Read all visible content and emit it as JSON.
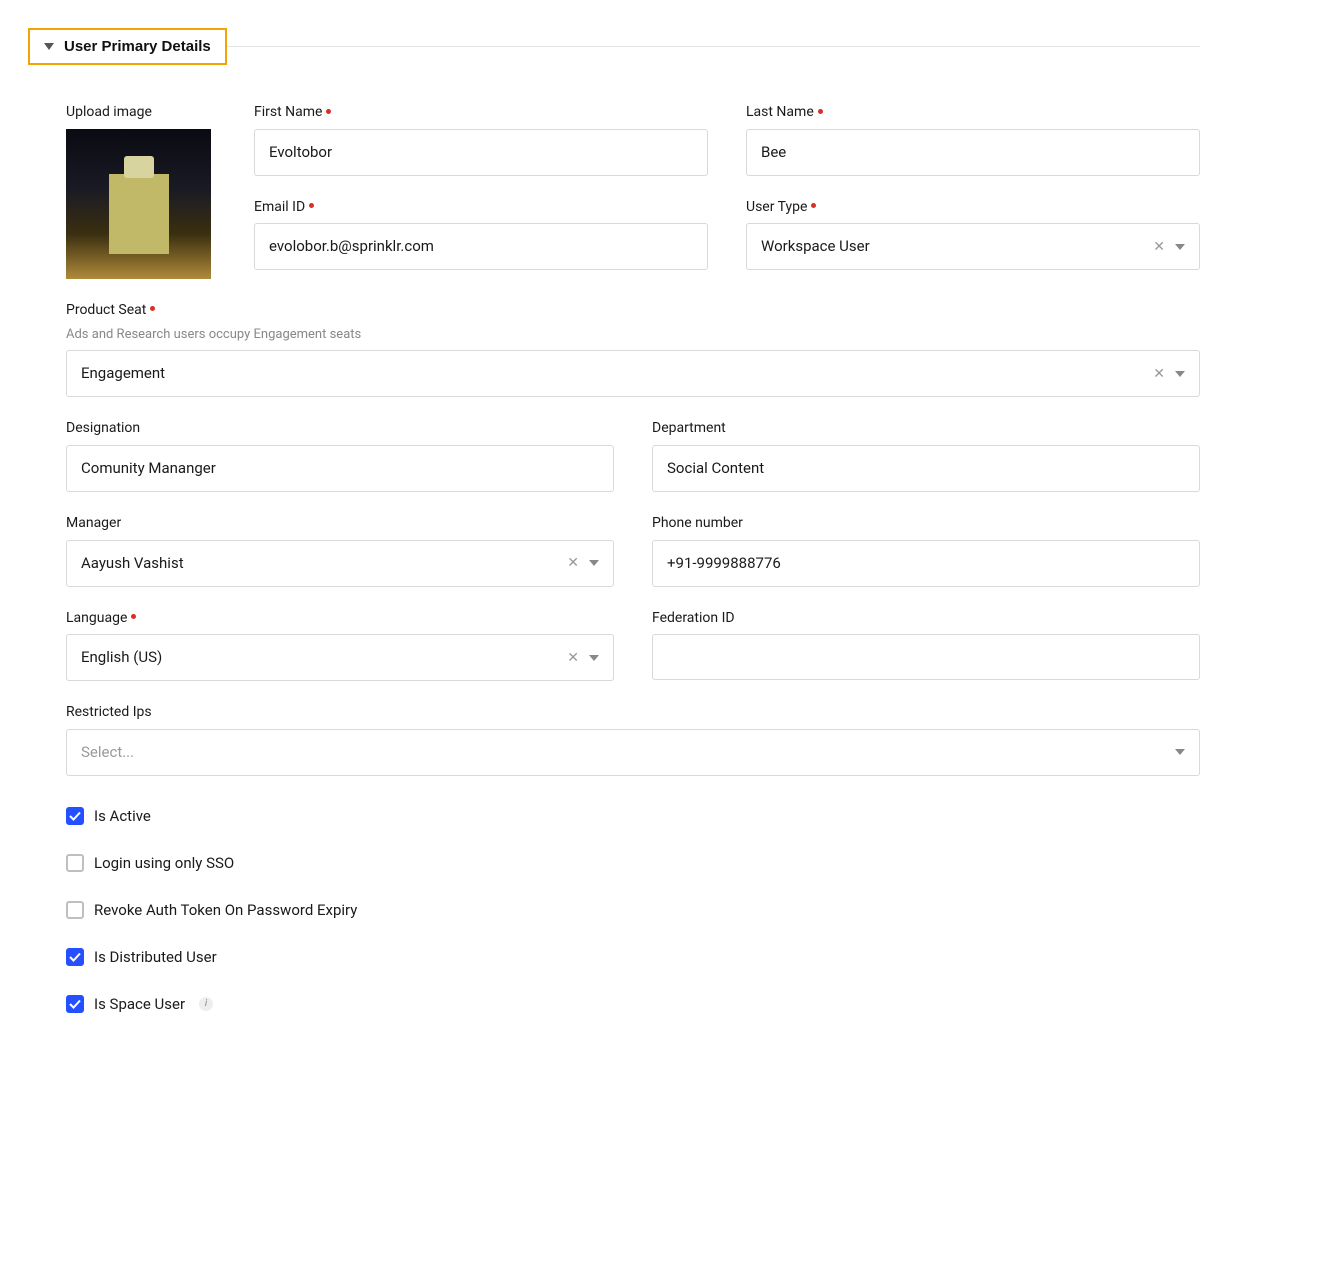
{
  "section": {
    "title": "User Primary Details"
  },
  "upload": {
    "label": "Upload image"
  },
  "first_name": {
    "label": "First Name",
    "value": "Evoltobor"
  },
  "last_name": {
    "label": "Last Name",
    "value": "Bee"
  },
  "email": {
    "label": "Email ID",
    "value": "evolobor.b@sprinklr.com"
  },
  "user_type": {
    "label": "User Type",
    "value": "Workspace User"
  },
  "product_seat": {
    "label": "Product Seat",
    "hint": "Ads and Research users occupy Engagement seats",
    "value": "Engagement"
  },
  "designation": {
    "label": "Designation",
    "value": "Comunity Mananger"
  },
  "department": {
    "label": "Department",
    "value": "Social Content"
  },
  "manager": {
    "label": "Manager",
    "value": "Aayush Vashist"
  },
  "phone": {
    "label": "Phone number",
    "value": "+91-9999888776"
  },
  "language": {
    "label": "Language",
    "value": "English (US)"
  },
  "federation": {
    "label": "Federation ID",
    "value": ""
  },
  "restricted_ips": {
    "label": "Restricted Ips",
    "placeholder": "Select..."
  },
  "checkboxes": {
    "is_active": {
      "label": "Is Active",
      "checked": true
    },
    "login_sso": {
      "label": "Login using only SSO",
      "checked": false
    },
    "revoke_token": {
      "label": "Revoke Auth Token On Password Expiry",
      "checked": false
    },
    "is_distributed": {
      "label": "Is Distributed User",
      "checked": true
    },
    "is_space": {
      "label": "Is Space User",
      "checked": true
    }
  }
}
